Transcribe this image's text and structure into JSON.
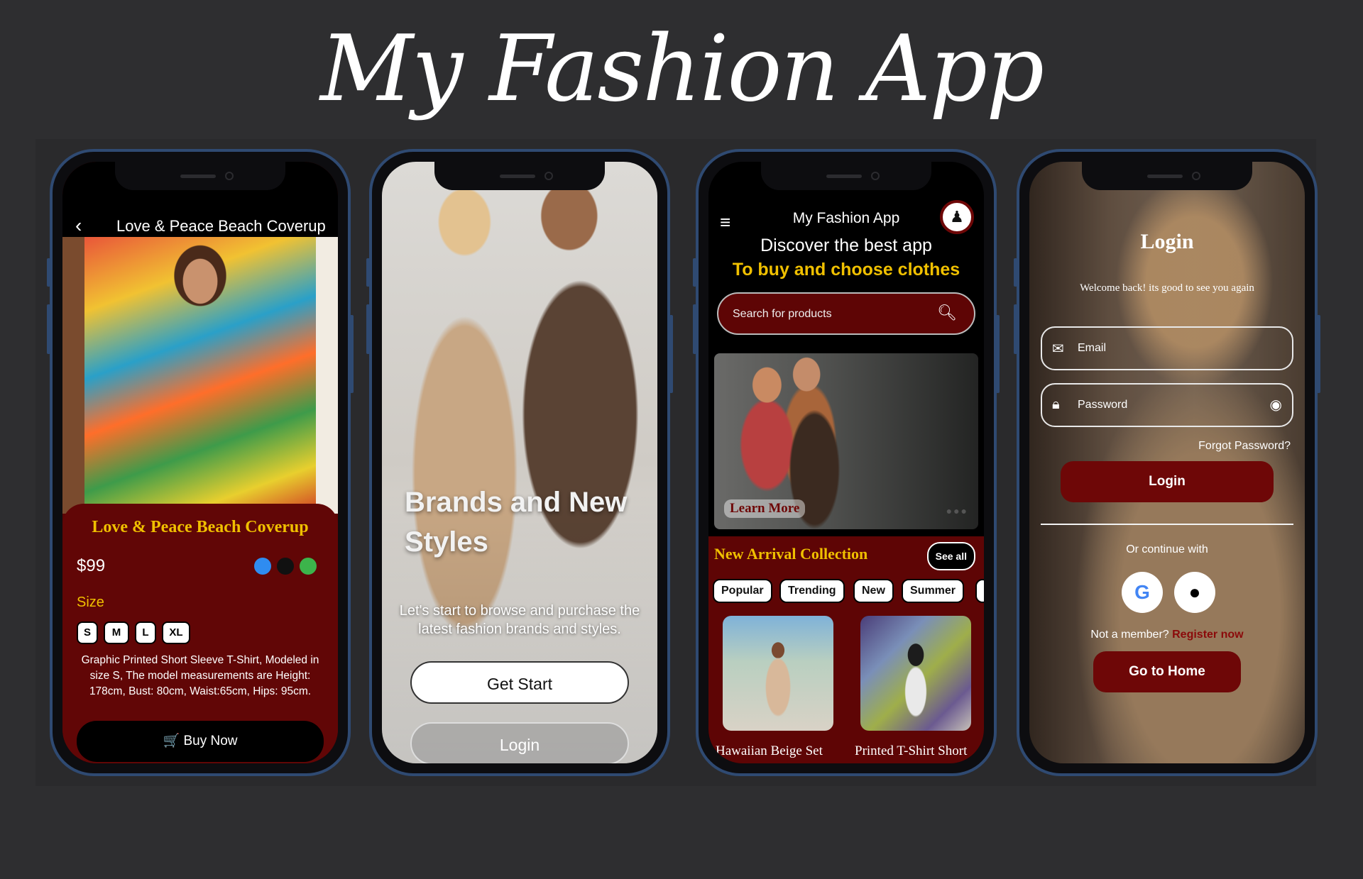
{
  "banner": {
    "title": "My Fashion App"
  },
  "product_screen": {
    "back_icon": "chevron-left-icon",
    "header_title": "Love & Peace Beach Coverup",
    "product_name": "Love & Peace Beach Coverup",
    "price": "$99",
    "colors": [
      "#2f8cf0",
      "#111111",
      "#3cb44b"
    ],
    "size_label": "Size",
    "sizes": [
      "S",
      "M",
      "L",
      "XL"
    ],
    "description": "Graphic Printed Short Sleeve T-Shirt, Modeled in size S, The model measurements are Height: 178cm, Bust: 80cm, Waist:65cm, Hips: 95cm.",
    "buy_icon": "cart-icon",
    "buy_label": "Buy Now"
  },
  "welcome_screen": {
    "heading": "Brands and New Styles",
    "subtitle": "Let's start to browse and purchase the latest fashion brands and styles.",
    "get_start_label": "Get Start",
    "login_label": "Login"
  },
  "home_screen": {
    "menu_icon": "hamburger-menu-icon",
    "app_title": "My Fashion App",
    "avatar_icon": "couple-avatar-icon",
    "discover_line1": "Discover the best app",
    "discover_line2": "To buy and choose clothes",
    "search_placeholder": "Search for products",
    "search_icon": "search-icon",
    "hero_button": "Learn More",
    "section_title": "New Arrival Collection",
    "see_all": "See all",
    "categories": [
      "Popular",
      "Trending",
      "New",
      "Summer"
    ],
    "products": [
      {
        "name": "Hawaiian Beige Set"
      },
      {
        "name": "Printed T-Shirt Short"
      }
    ]
  },
  "login_screen": {
    "title": "Login",
    "welcome": "Welcome back! its good to see you again",
    "email_icon": "envelope-icon",
    "email_placeholder": "Email",
    "password_icon": "lock-icon",
    "password_placeholder": "Password",
    "eye_icon": "eye-slash-icon",
    "forgot": "Forgot Password?",
    "login_button": "Login",
    "or_continue": "Or continue with",
    "social": [
      "google-icon",
      "apple-icon"
    ],
    "not_member": "Not a member?",
    "register": "Register now",
    "home_button": "Go to Home"
  },
  "colors": {
    "background": "#2e2e30",
    "maroon": "#610606",
    "gold": "#f0c000",
    "phone_frame": "#2f4a72"
  }
}
